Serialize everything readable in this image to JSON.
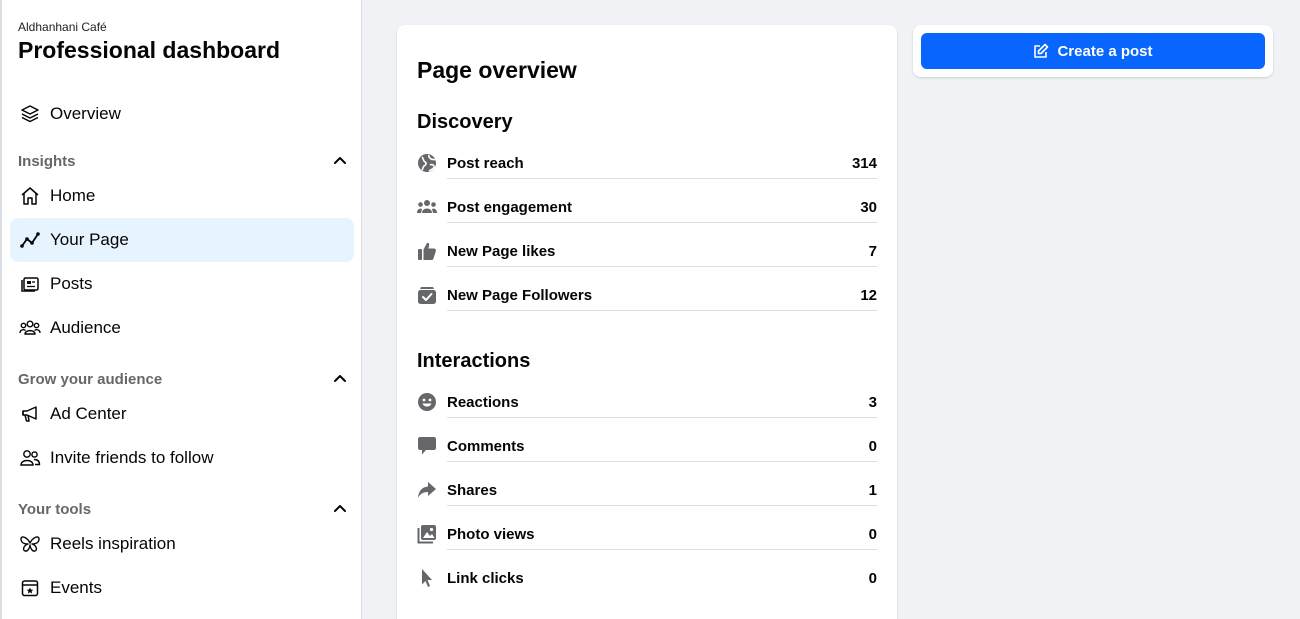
{
  "sidebar": {
    "page_name": "Aldhanhani Café",
    "title": "Professional dashboard",
    "overview": {
      "label": "Overview",
      "icon": "layers-icon"
    },
    "sections": [
      {
        "label": "Insights",
        "items": [
          {
            "label": "Home",
            "icon": "home-icon"
          },
          {
            "label": "Your Page",
            "icon": "trend-line-icon",
            "active": true
          },
          {
            "label": "Posts",
            "icon": "posts-icon"
          },
          {
            "label": "Audience",
            "icon": "audience-icon"
          }
        ]
      },
      {
        "label": "Grow your audience",
        "items": [
          {
            "label": "Ad Center",
            "icon": "megaphone-icon"
          },
          {
            "label": "Invite friends to follow",
            "icon": "invite-friends-icon"
          }
        ]
      },
      {
        "label": "Your tools",
        "items": [
          {
            "label": "Reels inspiration",
            "icon": "butterfly-icon"
          },
          {
            "label": "Events",
            "icon": "calendar-star-icon"
          }
        ]
      }
    ]
  },
  "overview": {
    "title": "Page overview",
    "groups": [
      {
        "label": "Discovery",
        "metrics": [
          {
            "label": "Post reach",
            "value": "314",
            "icon": "globe-icon"
          },
          {
            "label": "Post engagement",
            "value": "30",
            "icon": "people-icon"
          },
          {
            "label": "New Page likes",
            "value": "7",
            "icon": "thumbs-up-icon"
          },
          {
            "label": "New Page Followers",
            "value": "12",
            "icon": "follow-check-icon"
          }
        ]
      },
      {
        "label": "Interactions",
        "metrics": [
          {
            "label": "Reactions",
            "value": "3",
            "icon": "smiley-icon"
          },
          {
            "label": "Comments",
            "value": "0",
            "icon": "comment-icon"
          },
          {
            "label": "Shares",
            "value": "1",
            "icon": "share-arrow-icon"
          },
          {
            "label": "Photo views",
            "value": "0",
            "icon": "photo-icon"
          },
          {
            "label": "Link clicks",
            "value": "0",
            "icon": "cursor-icon"
          }
        ]
      }
    ]
  },
  "actions": {
    "create_post_label": "Create a post",
    "create_post_icon": "edit-icon"
  },
  "colors": {
    "accent": "#0866ff",
    "active_bg": "#e7f3ff",
    "icon_gray": "#65676b"
  }
}
